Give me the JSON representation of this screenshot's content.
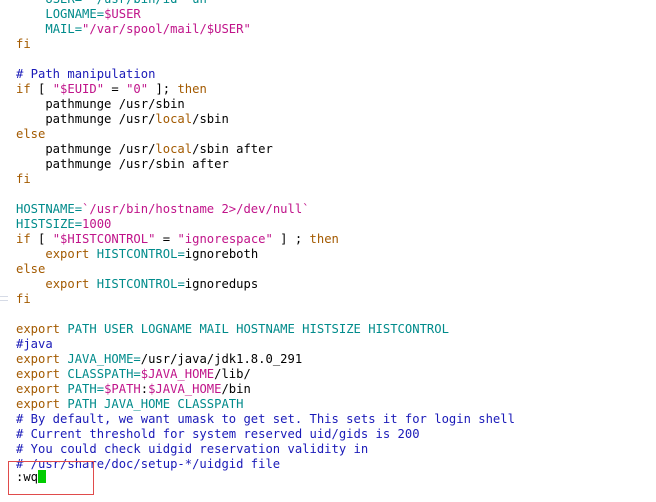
{
  "colors": {
    "comment": "#1a1ab8",
    "keyword": "#a35a00",
    "identifier": "#008b8b",
    "string": "#c0148a",
    "plain": "#000000",
    "cursor": "#00cc00",
    "annotation_box": "#e04b4b"
  },
  "lines": [
    [
      {
        "t": "    ",
        "c": "plain"
      },
      {
        "t": "USER=\"`/usr/bin/id -un`\"",
        "c": "identifier"
      }
    ],
    [
      {
        "t": "    ",
        "c": "plain"
      },
      {
        "t": "LOGNAME=",
        "c": "identifier"
      },
      {
        "t": "$USER",
        "c": "string"
      }
    ],
    [
      {
        "t": "    ",
        "c": "plain"
      },
      {
        "t": "MAIL=",
        "c": "identifier"
      },
      {
        "t": "\"/var/spool/mail/$USER\"",
        "c": "string"
      }
    ],
    [
      {
        "t": "fi",
        "c": "keyword"
      }
    ],
    [],
    [
      {
        "t": "# Path manipulation",
        "c": "comment"
      }
    ],
    [
      {
        "t": "if",
        "c": "keyword"
      },
      {
        "t": " [ ",
        "c": "plain"
      },
      {
        "t": "\"$EUID\"",
        "c": "string"
      },
      {
        "t": " = ",
        "c": "plain"
      },
      {
        "t": "\"0\"",
        "c": "string"
      },
      {
        "t": " ]; ",
        "c": "plain"
      },
      {
        "t": "then",
        "c": "keyword"
      }
    ],
    [
      {
        "t": "    pathmunge /usr/sbin",
        "c": "plain"
      }
    ],
    [
      {
        "t": "    pathmunge /usr/",
        "c": "plain"
      },
      {
        "t": "local",
        "c": "keyword"
      },
      {
        "t": "/sbin",
        "c": "plain"
      }
    ],
    [
      {
        "t": "else",
        "c": "keyword"
      }
    ],
    [
      {
        "t": "    pathmunge /usr/",
        "c": "plain"
      },
      {
        "t": "local",
        "c": "keyword"
      },
      {
        "t": "/sbin after",
        "c": "plain"
      }
    ],
    [
      {
        "t": "    pathmunge /usr/sbin after",
        "c": "plain"
      }
    ],
    [
      {
        "t": "fi",
        "c": "keyword"
      }
    ],
    [],
    [
      {
        "t": "HOSTNAME=",
        "c": "identifier"
      },
      {
        "t": "`/usr/bin/hostname 2>/dev/null`",
        "c": "string"
      }
    ],
    [
      {
        "t": "HISTSIZE=",
        "c": "identifier"
      },
      {
        "t": "1000",
        "c": "string"
      }
    ],
    [
      {
        "t": "if",
        "c": "keyword"
      },
      {
        "t": " [ ",
        "c": "plain"
      },
      {
        "t": "\"$HISTCONTROL\"",
        "c": "string"
      },
      {
        "t": " = ",
        "c": "plain"
      },
      {
        "t": "\"ignorespace\"",
        "c": "string"
      },
      {
        "t": " ] ; ",
        "c": "plain"
      },
      {
        "t": "then",
        "c": "keyword"
      }
    ],
    [
      {
        "t": "    ",
        "c": "plain"
      },
      {
        "t": "export",
        "c": "keyword"
      },
      {
        "t": " ",
        "c": "plain"
      },
      {
        "t": "HISTCONTROL=",
        "c": "identifier"
      },
      {
        "t": "ignoreboth",
        "c": "plain"
      }
    ],
    [
      {
        "t": "else",
        "c": "keyword"
      }
    ],
    [
      {
        "t": "    ",
        "c": "plain"
      },
      {
        "t": "export",
        "c": "keyword"
      },
      {
        "t": " ",
        "c": "plain"
      },
      {
        "t": "HISTCONTROL=",
        "c": "identifier"
      },
      {
        "t": "ignoredups",
        "c": "plain"
      }
    ],
    [
      {
        "t": "fi",
        "c": "keyword"
      }
    ],
    [],
    [
      {
        "t": "export",
        "c": "keyword"
      },
      {
        "t": " PATH USER LOGNAME MAIL HOSTNAME HISTSIZE HISTCONTROL",
        "c": "identifier"
      }
    ],
    [
      {
        "t": "#java",
        "c": "comment"
      }
    ],
    [
      {
        "t": "export",
        "c": "keyword"
      },
      {
        "t": " ",
        "c": "plain"
      },
      {
        "t": "JAVA_HOME=",
        "c": "identifier"
      },
      {
        "t": "/usr/java/jdk1.8.0_291",
        "c": "plain"
      }
    ],
    [
      {
        "t": "export",
        "c": "keyword"
      },
      {
        "t": " ",
        "c": "plain"
      },
      {
        "t": "CLASSPATH=",
        "c": "identifier"
      },
      {
        "t": "$JAVA_HOME",
        "c": "string"
      },
      {
        "t": "/lib/",
        "c": "plain"
      }
    ],
    [
      {
        "t": "export",
        "c": "keyword"
      },
      {
        "t": " ",
        "c": "plain"
      },
      {
        "t": "PATH=",
        "c": "identifier"
      },
      {
        "t": "$PATH",
        "c": "string"
      },
      {
        "t": ":",
        "c": "plain"
      },
      {
        "t": "$JAVA_HOME",
        "c": "string"
      },
      {
        "t": "/bin",
        "c": "plain"
      }
    ],
    [
      {
        "t": "export",
        "c": "keyword"
      },
      {
        "t": " PATH JAVA_HOME CLASSPATH",
        "c": "identifier"
      }
    ],
    [
      {
        "t": "# By default, we want umask to get set. This sets it for login shell",
        "c": "comment"
      }
    ],
    [
      {
        "t": "# Current threshold for system reserved uid/gids is 200",
        "c": "comment"
      }
    ],
    [
      {
        "t": "# You could check uidgid reservation validity in",
        "c": "comment"
      }
    ],
    [
      {
        "t": "# /usr/share/doc/setup-*/uidgid file",
        "c": "comment"
      }
    ]
  ],
  "command_line": {
    "text": ":wq"
  }
}
